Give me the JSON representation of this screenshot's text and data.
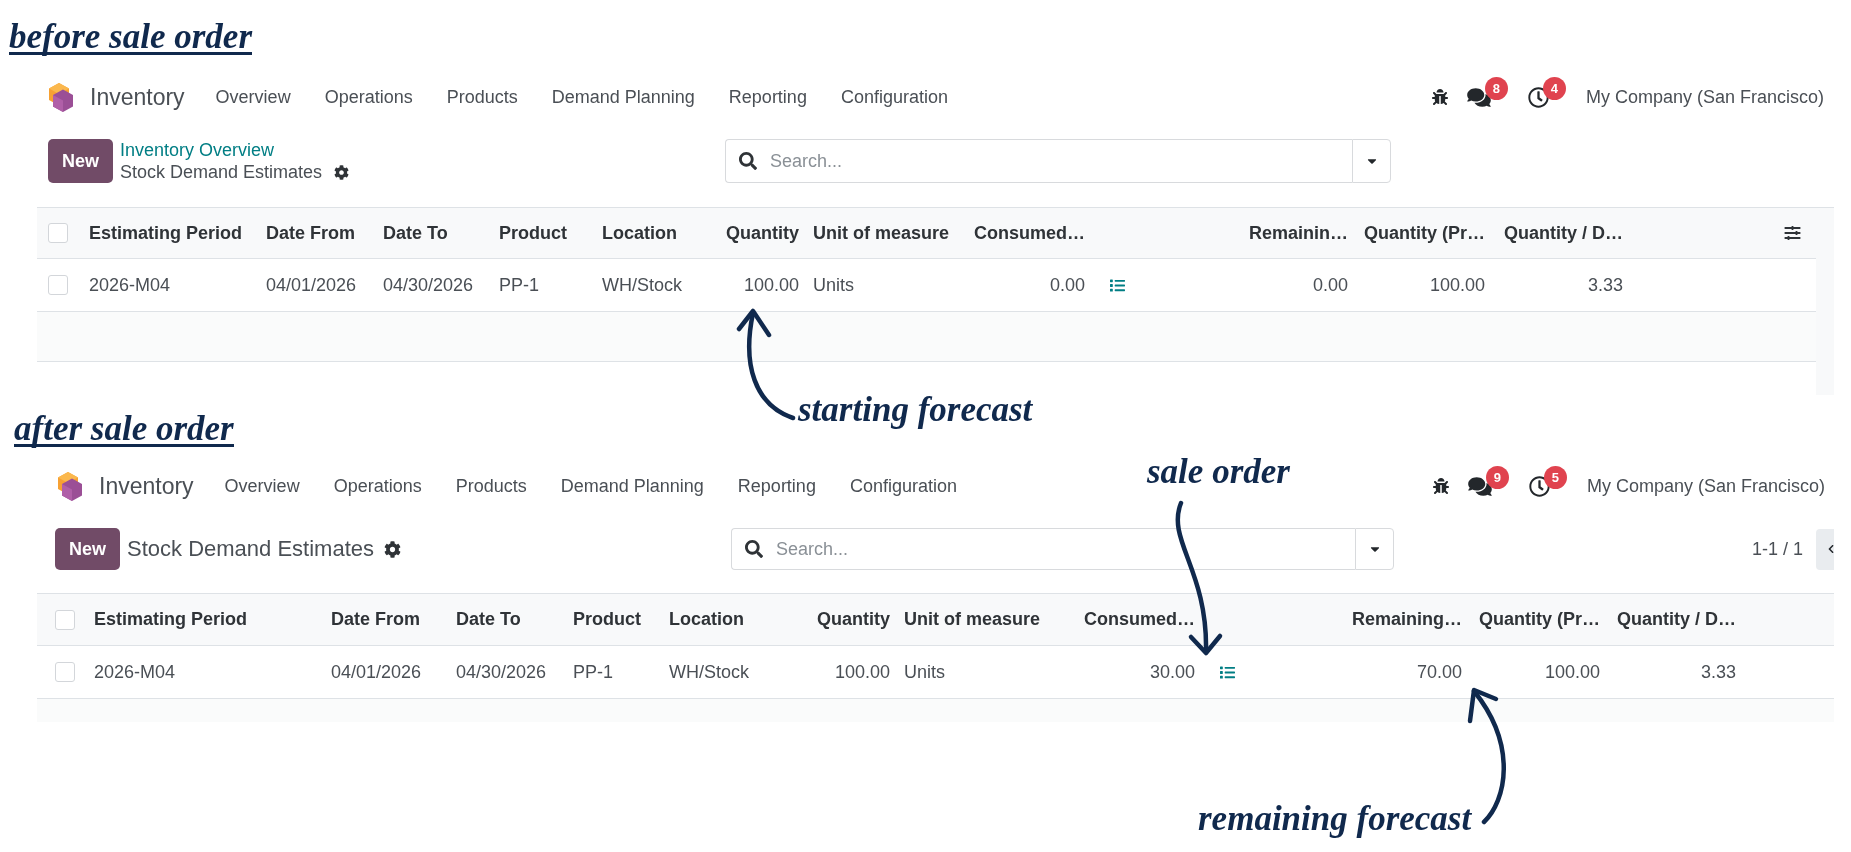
{
  "sections": [
    {
      "heading": "before sale order",
      "navbar": {
        "app_name": "Inventory",
        "menu": [
          "Overview",
          "Operations",
          "Products",
          "Demand Planning",
          "Reporting",
          "Configuration"
        ],
        "systray": [
          {
            "kind": "debug"
          },
          {
            "kind": "messages",
            "badge": "8"
          },
          {
            "kind": "activities",
            "badge": "4"
          }
        ],
        "company": "My Company (San Francisco)"
      },
      "control_panel": {
        "new_button": "New",
        "breadcrumb": [
          "Inventory Overview"
        ],
        "title": "Stock Demand Estimates",
        "search": {
          "placeholder": "Search..."
        }
      },
      "list": {
        "select_all_checked": false,
        "optional_columns_toggle": true,
        "columns": [
          {
            "label": "Estimating Period",
            "kind": "text"
          },
          {
            "label": "Date From",
            "kind": "text"
          },
          {
            "label": "Date To",
            "kind": "text"
          },
          {
            "label": "Product",
            "kind": "text"
          },
          {
            "label": "Location",
            "kind": "text"
          },
          {
            "label": "Quantity",
            "kind": "number"
          },
          {
            "label": "Unit of measure",
            "kind": "text"
          },
          {
            "label": "Consumed…",
            "kind": "number",
            "details_button": true
          },
          {
            "label": "Remainin…",
            "kind": "number"
          },
          {
            "label": "Quantity (Pr…",
            "kind": "number"
          },
          {
            "label": "Quantity / D…",
            "kind": "number"
          }
        ],
        "rows": [
          {
            "checked": false,
            "cells": [
              "2026-M04",
              "04/01/2026",
              "04/30/2026",
              "PP-1",
              "WH/Stock",
              "100.00",
              "Units",
              "0.00",
              "0.00",
              "100.00",
              "3.33"
            ]
          }
        ]
      },
      "annotations": [
        "starting forecast"
      ]
    },
    {
      "heading": "after sale order",
      "navbar": {
        "app_name": "Inventory",
        "menu": [
          "Overview",
          "Operations",
          "Products",
          "Demand Planning",
          "Reporting",
          "Configuration"
        ],
        "systray": [
          {
            "kind": "debug"
          },
          {
            "kind": "messages",
            "badge": "9"
          },
          {
            "kind": "activities",
            "badge": "5"
          }
        ],
        "company": "My Company (San Francisco)"
      },
      "control_panel": {
        "new_button": "New",
        "title": "Stock Demand Estimates",
        "search": {
          "placeholder": "Search..."
        },
        "pager": "1-1 / 1"
      },
      "list": {
        "select_all_checked": false,
        "columns": [
          {
            "label": "Estimating Period",
            "kind": "text"
          },
          {
            "label": "Date From",
            "kind": "text"
          },
          {
            "label": "Date To",
            "kind": "text"
          },
          {
            "label": "Product",
            "kind": "text"
          },
          {
            "label": "Location",
            "kind": "text"
          },
          {
            "label": "Quantity",
            "kind": "number"
          },
          {
            "label": "Unit of measure",
            "kind": "text"
          },
          {
            "label": "Consumed…",
            "kind": "number",
            "details_button": true
          },
          {
            "label": "Remaining…",
            "kind": "number"
          },
          {
            "label": "Quantity (Pr…",
            "kind": "number"
          },
          {
            "label": "Quantity / D…",
            "kind": "number"
          }
        ],
        "rows": [
          {
            "checked": false,
            "cells": [
              "2026-M04",
              "04/01/2026",
              "04/30/2026",
              "PP-1",
              "WH/Stock",
              "100.00",
              "Units",
              "30.00",
              "70.00",
              "100.00",
              "3.33"
            ]
          }
        ]
      },
      "annotations": [
        "sale order",
        "remaining forecast"
      ]
    }
  ]
}
